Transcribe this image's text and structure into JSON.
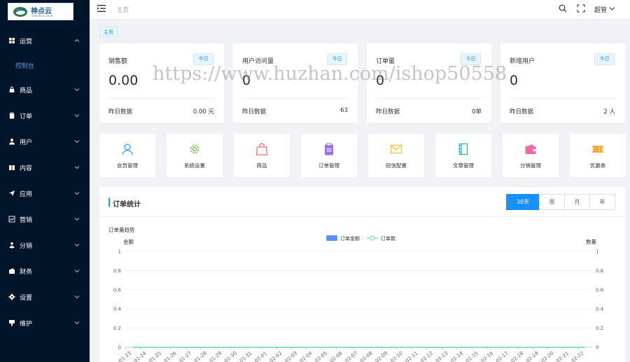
{
  "brand": {
    "name": "神点云",
    "sub": "shendian.cloud"
  },
  "sidebar": {
    "items": [
      {
        "label": "运营",
        "icon": "grid-icon"
      },
      {
        "label": "商品",
        "icon": "bag-icon"
      },
      {
        "label": "订单",
        "icon": "clipboard-icon"
      },
      {
        "label": "用户",
        "icon": "user-icon"
      },
      {
        "label": "内容",
        "icon": "book-icon"
      },
      {
        "label": "应用",
        "icon": "send-icon"
      },
      {
        "label": "营销",
        "icon": "chart-icon"
      },
      {
        "label": "分销",
        "icon": "users-icon"
      },
      {
        "label": "财务",
        "icon": "wallet-icon"
      },
      {
        "label": "设置",
        "icon": "gear-icon"
      },
      {
        "label": "维护",
        "icon": "wrench-icon"
      }
    ],
    "sub_item": "控制台"
  },
  "header": {
    "breadcrumb": "主页",
    "user": "超管"
  },
  "tagbar": {
    "tag": "主页"
  },
  "stats": [
    {
      "title": "销售额",
      "badge": "今日",
      "value": "0.00",
      "foot_label": "昨日数据",
      "foot_value": "0.00 元"
    },
    {
      "title": "用户访问量",
      "badge": "今日",
      "value": "0",
      "foot_label": "昨日数据",
      "foot_value": "63"
    },
    {
      "title": "订单量",
      "badge": "今日",
      "value": "0",
      "foot_label": "昨日数据",
      "foot_value": "0单"
    },
    {
      "title": "新增用户",
      "badge": "今日",
      "value": "0",
      "foot_label": "昨日数据",
      "foot_value": "2 人"
    }
  ],
  "quick_nav": [
    {
      "label": "会员管理",
      "icon": "user-outline-icon",
      "color": "#409eff"
    },
    {
      "label": "系统设置",
      "icon": "gear-outline-icon",
      "color": "#67c23a"
    },
    {
      "label": "商品",
      "icon": "bag-outline-icon",
      "color": "#f56c6c"
    },
    {
      "label": "订单管理",
      "icon": "clipboard-fill-icon",
      "color": "#9d6ee8"
    },
    {
      "label": "短信配置",
      "icon": "mail-icon",
      "color": "#f5c542"
    },
    {
      "label": "文章管理",
      "icon": "notebook-icon",
      "color": "#18b9b1"
    },
    {
      "label": "分销管理",
      "icon": "wallet-fill-icon",
      "color": "#f06aa8"
    },
    {
      "label": "优惠券",
      "icon": "ticket-icon",
      "color": "#f7a93b"
    }
  ],
  "order_panel": {
    "title": "订单统计",
    "ranges": [
      "30天",
      "周",
      "月",
      "年"
    ],
    "active_range": "30天"
  },
  "watermark": "https://www.huzhan.com/ishop50558",
  "chart_data": {
    "type": "line",
    "title": "订单量趋势",
    "left_axis_label": "金额",
    "right_axis_label": "数量",
    "legend": [
      "订单金额",
      "订单数"
    ],
    "legend_position": "top-center",
    "series_colors": [
      "#5b8ff9",
      "#5ad8c0"
    ],
    "y_ticks": [
      "1",
      "0.8",
      "0.6",
      "0.4",
      "0.2",
      "0"
    ],
    "ylim": [
      0,
      1
    ],
    "categories": [
      "01-23",
      "01-24",
      "01-25",
      "01-26",
      "01-27",
      "01-28",
      "01-29",
      "01-30",
      "01-31",
      "02-01",
      "02-02",
      "02-03",
      "02-04",
      "02-05",
      "02-06",
      "02-07",
      "02-08",
      "02-09",
      "02-10",
      "02-11",
      "02-12",
      "02-13",
      "02-14",
      "02-15",
      "02-16",
      "02-17",
      "02-18",
      "02-19",
      "02-20",
      "02-21",
      "02-22"
    ],
    "series": [
      {
        "name": "订单金额",
        "type": "bar",
        "values": [
          0,
          0,
          0,
          0,
          0,
          0,
          0,
          0,
          0,
          0,
          0,
          0,
          0,
          0,
          0,
          0,
          0,
          0,
          0,
          0,
          0,
          0,
          0,
          0,
          0,
          0,
          0,
          0,
          0,
          0,
          0
        ]
      },
      {
        "name": "订单数",
        "type": "line",
        "values": [
          0,
          0,
          0,
          0,
          0,
          0,
          0,
          0,
          0,
          0,
          0,
          0,
          0,
          0,
          0,
          0,
          0,
          0,
          0,
          0,
          0,
          0,
          0,
          0,
          0,
          0,
          0,
          0,
          0,
          0,
          0
        ]
      }
    ]
  }
}
